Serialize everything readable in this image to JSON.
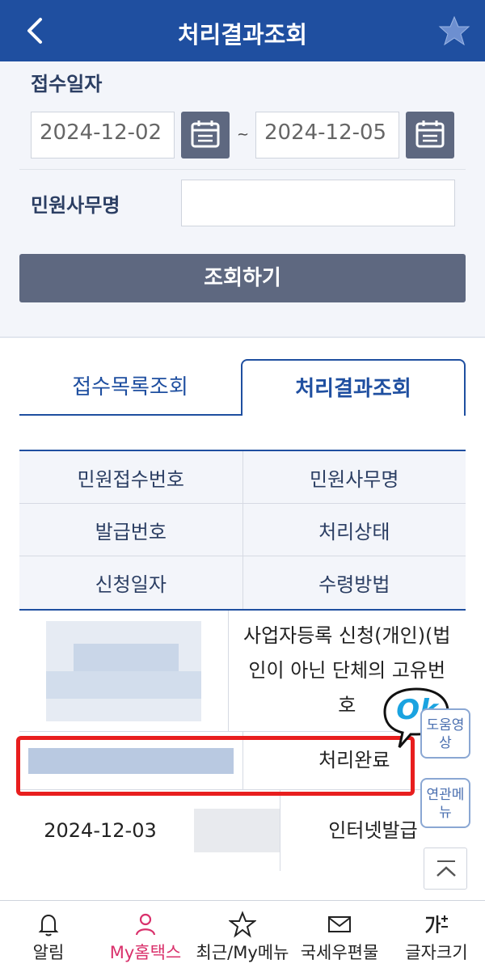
{
  "header": {
    "title": "처리결과조회"
  },
  "search": {
    "date_label": "접수일자",
    "date_from": "2024-12-02",
    "date_to": "2024-12-05",
    "tilde": "~",
    "office_label": "민원사무명",
    "office_value": "",
    "submit_label": "조회하기"
  },
  "tabs": [
    {
      "label": "접수목록조회",
      "active": false
    },
    {
      "label": "처리결과조회",
      "active": true
    }
  ],
  "table": {
    "headers": [
      [
        "민원접수번호",
        "민원사무명"
      ],
      [
        "발급번호",
        "처리상태"
      ],
      [
        "신청일자",
        "수령방법"
      ]
    ],
    "row": {
      "office_name": "사업자등록 신청(개인)(법인이 아닌 단체의 고유번호",
      "status": "처리완료",
      "date": "2024-12-03",
      "receive_method": "인터넷발급"
    }
  },
  "callout": {
    "text": "Ok"
  },
  "side_buttons": {
    "guide": "도움영상",
    "related": "연관메뉴"
  },
  "bottom_nav": [
    {
      "label": "알림",
      "icon": "bell-icon"
    },
    {
      "label": "My홈택스",
      "icon": "person-icon",
      "active": true
    },
    {
      "label": "최근/My메뉴",
      "icon": "star-icon"
    },
    {
      "label": "국세우편물",
      "icon": "mail-icon"
    },
    {
      "label": "글자크기",
      "icon": "text-size-icon"
    }
  ],
  "colors": {
    "header": "#1f4fa0",
    "accent": "#d9306b",
    "highlight": "#e81e1e"
  }
}
